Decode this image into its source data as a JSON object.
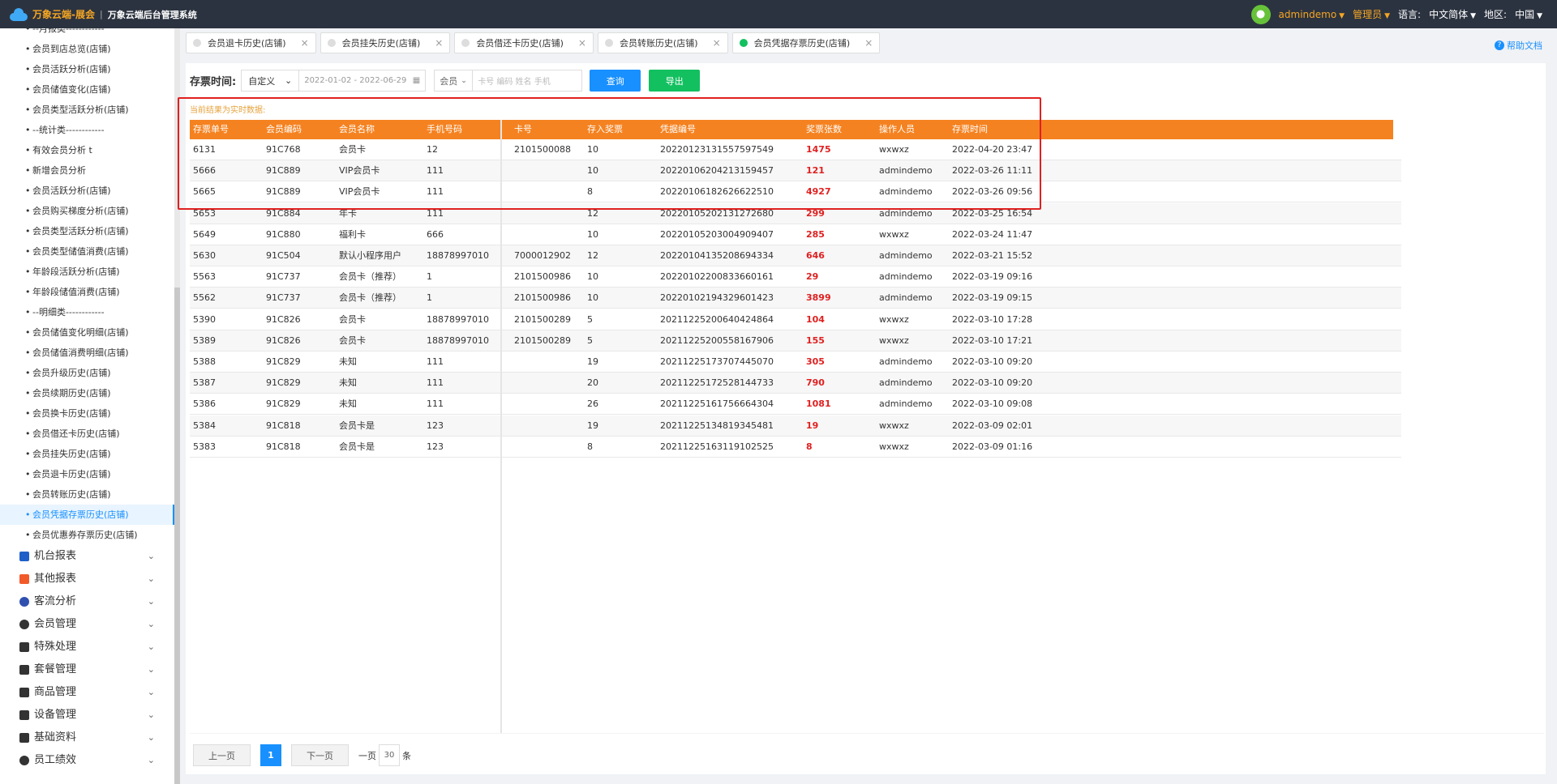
{
  "header": {
    "brand": "万象云端-展会",
    "separator": "|",
    "system_title": "万象云端后台管理系统",
    "username": "admindemo",
    "role": "管理员",
    "language_label": "语言:",
    "language_value": "中文简体",
    "region_label": "地区:",
    "region_value": "中国"
  },
  "sidebar": {
    "sub_items": [
      {
        "label": "--月报类------------",
        "dot": "•"
      },
      {
        "label": "会员到店总览(店铺)",
        "dot": "•"
      },
      {
        "label": "会员活跃分析(店铺)",
        "dot": "•"
      },
      {
        "label": "会员储值变化(店铺)",
        "dot": "•"
      },
      {
        "label": "会员类型活跃分析(店铺)",
        "dot": "•"
      },
      {
        "label": "--统计类------------",
        "dot": "•"
      },
      {
        "label": "有效会员分析 t",
        "dot": "•"
      },
      {
        "label": "新增会员分析",
        "dot": "•"
      },
      {
        "label": "会员活跃分析(店铺)",
        "dot": "•"
      },
      {
        "label": "会员购买梯度分析(店铺)",
        "dot": "•"
      },
      {
        "label": "会员类型活跃分析(店铺)",
        "dot": "•"
      },
      {
        "label": "会员类型储值消费(店铺)",
        "dot": "•"
      },
      {
        "label": "年龄段活跃分析(店铺)",
        "dot": "•"
      },
      {
        "label": "年龄段储值消费(店铺)",
        "dot": "•"
      },
      {
        "label": "--明细类------------",
        "dot": "•"
      },
      {
        "label": "会员储值变化明细(店铺)",
        "dot": "•"
      },
      {
        "label": "会员储值消费明细(店铺)",
        "dot": "•"
      },
      {
        "label": "会员升级历史(店铺)",
        "dot": "•"
      },
      {
        "label": "会员续期历史(店铺)",
        "dot": "•"
      },
      {
        "label": "会员换卡历史(店铺)",
        "dot": "•"
      },
      {
        "label": "会员借还卡历史(店铺)",
        "dot": "•"
      },
      {
        "label": "会员挂失历史(店铺)",
        "dot": "•"
      },
      {
        "label": "会员退卡历史(店铺)",
        "dot": "•"
      },
      {
        "label": "会员转账历史(店铺)",
        "dot": "•"
      },
      {
        "label": "会员凭据存票历史(店铺)",
        "dot": "•"
      },
      {
        "label": "会员优惠券存票历史(店铺)",
        "dot": "•"
      }
    ],
    "active_index": 24,
    "groups": [
      {
        "label": "机台报表",
        "icon": "machine-report-icon",
        "color": "#1e60c8"
      },
      {
        "label": "其他报表",
        "icon": "layers-icon",
        "color": "#f25a2a"
      },
      {
        "label": "客流分析",
        "icon": "target-icon",
        "color": "#3050b0"
      },
      {
        "label": "会员管理",
        "icon": "member-icon",
        "color": "#333333"
      },
      {
        "label": "特殊处理",
        "icon": "warning-icon",
        "color": "#333333"
      },
      {
        "label": "套餐管理",
        "icon": "edit-icon",
        "color": "#333333"
      },
      {
        "label": "商品管理",
        "icon": "swap-icon",
        "color": "#333333"
      },
      {
        "label": "设备管理",
        "icon": "device-icon",
        "color": "#333333"
      },
      {
        "label": "基础资料",
        "icon": "document-icon",
        "color": "#333333"
      },
      {
        "label": "员工绩效",
        "icon": "gear-icon",
        "color": "#333333"
      }
    ]
  },
  "tabs": [
    {
      "label": "会员退卡历史(店铺)",
      "active": false
    },
    {
      "label": "会员挂失历史(店铺)",
      "active": false
    },
    {
      "label": "会员借还卡历史(店铺)",
      "active": false
    },
    {
      "label": "会员转账历史(店铺)",
      "active": false
    },
    {
      "label": "会员凭据存票历史(店铺)",
      "active": true
    }
  ],
  "tab_close": "×",
  "help_label": "帮助文档",
  "filter": {
    "label": "存票时间:",
    "mode": "自定义",
    "date_range": "2022-01-02 - 2022-06-29",
    "member_select": "会员",
    "search_placeholder": "卡号 编码 姓名 手机",
    "query_label": "查询",
    "export_label": "导出"
  },
  "notice": "当前结果为实时数据:",
  "table": {
    "columns": [
      "存票单号",
      "会员编码",
      "会员名称",
      "手机号码",
      "卡号",
      "存入奖票",
      "凭据编号",
      "奖票张数",
      "操作人员",
      "存票时间"
    ],
    "rows": [
      [
        "6131",
        "91C768",
        "会员卡",
        "12",
        "2101500088",
        "10",
        "20220123131557597549",
        "1475",
        "wxwxz",
        "2022-04-20 23:47"
      ],
      [
        "5666",
        "91C889",
        "VIP会员卡",
        "111",
        "",
        "10",
        "20220106204213159457",
        "121",
        "admindemo",
        "2022-03-26 11:11"
      ],
      [
        "5665",
        "91C889",
        "VIP会员卡",
        "111",
        "",
        "8",
        "20220106182626622510",
        "4927",
        "admindemo",
        "2022-03-26 09:56"
      ],
      [
        "5653",
        "91C884",
        "年卡",
        "111",
        "",
        "12",
        "20220105202131272680",
        "299",
        "admindemo",
        "2022-03-25 16:54"
      ],
      [
        "5649",
        "91C880",
        "福利卡",
        "666",
        "",
        "10",
        "20220105203004909407",
        "285",
        "wxwxz",
        "2022-03-24 11:47"
      ],
      [
        "5630",
        "91C504",
        "默认小程序用户",
        "18878997010",
        "7000012902",
        "12",
        "20220104135208694334",
        "646",
        "admindemo",
        "2022-03-21 15:52"
      ],
      [
        "5563",
        "91C737",
        "会员卡（推荐）",
        "1",
        "2101500986",
        "10",
        "20220102200833660161",
        "29",
        "admindemo",
        "2022-03-19 09:16"
      ],
      [
        "5562",
        "91C737",
        "会员卡（推荐）",
        "1",
        "2101500986",
        "10",
        "20220102194329601423",
        "3899",
        "admindemo",
        "2022-03-19 09:15"
      ],
      [
        "5390",
        "91C826",
        "会员卡",
        "18878997010",
        "2101500289",
        "5",
        "20211225200640424864",
        "104",
        "wxwxz",
        "2022-03-10 17:28"
      ],
      [
        "5389",
        "91C826",
        "会员卡",
        "18878997010",
        "2101500289",
        "5",
        "20211225200558167906",
        "155",
        "wxwxz",
        "2022-03-10 17:21"
      ],
      [
        "5388",
        "91C829",
        "未知",
        "111",
        "",
        "19",
        "20211225173707445070",
        "305",
        "admindemo",
        "2022-03-10 09:20"
      ],
      [
        "5387",
        "91C829",
        "未知",
        "111",
        "",
        "20",
        "20211225172528144733",
        "790",
        "admindemo",
        "2022-03-10 09:20"
      ],
      [
        "5386",
        "91C829",
        "未知",
        "111",
        "",
        "26",
        "20211225161756664304",
        "1081",
        "admindemo",
        "2022-03-10 09:08"
      ],
      [
        "5384",
        "91C818",
        "会员卡是",
        "123",
        "",
        "19",
        "20211225134819345481",
        "19",
        "wxwxz",
        "2022-03-09 02:01"
      ],
      [
        "5383",
        "91C818",
        "会员卡是",
        "123",
        "",
        "8",
        "20211225163119102525",
        "8",
        "wxwxz",
        "2022-03-09 01:16"
      ]
    ]
  },
  "pager": {
    "prev": "上一页",
    "current": "1",
    "next": "下一页",
    "per_page_label": "一页",
    "per_page": "30",
    "unit": "条"
  },
  "colors": {
    "topbar": "#2c3340",
    "brand": "#f5a623",
    "header_row": "#f58220",
    "primary": "#1890ff",
    "success": "#13c060",
    "highlight_border": "#e02020",
    "ticket_count": "#e02020"
  }
}
